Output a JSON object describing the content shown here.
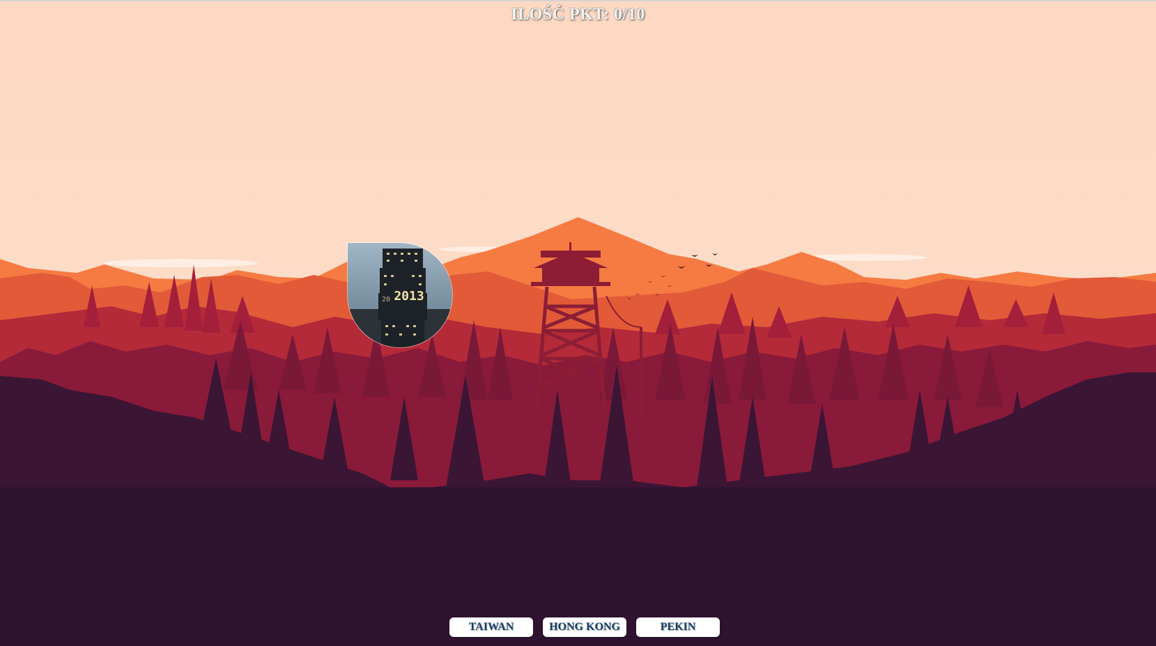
{
  "game": {
    "score_label": "ILOŚĆ PKT: 0/10"
  },
  "question": {
    "image_icon": "taipei-101-photo",
    "photo_text": "2013"
  },
  "answers": [
    {
      "label": "TAIWAN"
    },
    {
      "label": "HONG KONG"
    },
    {
      "label": "PEKIN"
    }
  ],
  "colors": {
    "sky": "#fdd9c4",
    "mountains_far": "#f07a3f",
    "mountains_mid": "#d64a32",
    "forest_red": "#9c1f3a",
    "forest_dark": "#2e1230",
    "button_bg": "#ffffff",
    "button_text": "#1e3a5f"
  }
}
